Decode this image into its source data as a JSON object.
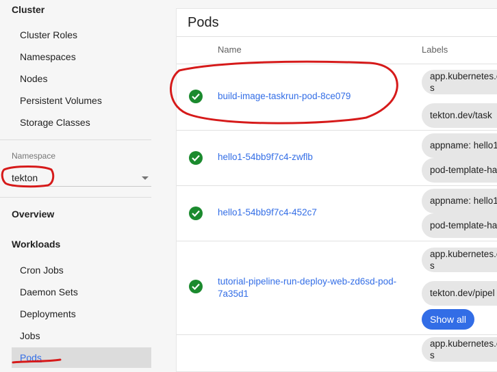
{
  "sidebar": {
    "cluster_heading": "Cluster",
    "cluster_items": [
      {
        "label": "Cluster Roles"
      },
      {
        "label": "Namespaces"
      },
      {
        "label": "Nodes"
      },
      {
        "label": "Persistent Volumes"
      },
      {
        "label": "Storage Classes"
      }
    ],
    "namespace_label": "Namespace",
    "namespace_value": "tekton",
    "overview_label": "Overview",
    "workloads_heading": "Workloads",
    "workload_items": [
      {
        "label": "Cron Jobs"
      },
      {
        "label": "Daemon Sets"
      },
      {
        "label": "Deployments"
      },
      {
        "label": "Jobs"
      },
      {
        "label": "Pods",
        "selected": true
      }
    ]
  },
  "main": {
    "title": "Pods",
    "columns": {
      "name": "Name",
      "labels": "Labels"
    },
    "rows": [
      {
        "name": "build-image-taskrun-pod-8ce079",
        "status": "running",
        "labels": [
          "app.kubernetes.elines",
          "tekton.dev/task"
        ]
      },
      {
        "name": "hello1-54bb9f7c4-zwflb",
        "status": "running",
        "labels": [
          "appname: hello1",
          "pod-template-ha"
        ]
      },
      {
        "name": "hello1-54bb9f7c4-452c7",
        "status": "running",
        "labels": [
          "appname: hello1",
          "pod-template-ha"
        ]
      },
      {
        "name_line1": "tutorial-pipeline-run-deploy-web-zd6sd-pod-",
        "name_line2": "7a35d1",
        "status": "running",
        "labels": [
          "app.kubernetes.elines",
          "tekton.dev/pipel"
        ],
        "show_all": "Show all"
      },
      {
        "labels": [
          "app.kubernetes.elines"
        ]
      }
    ]
  },
  "colors": {
    "accent": "#326de6",
    "success": "#1b8a2e",
    "annotation": "#d61a1a"
  }
}
